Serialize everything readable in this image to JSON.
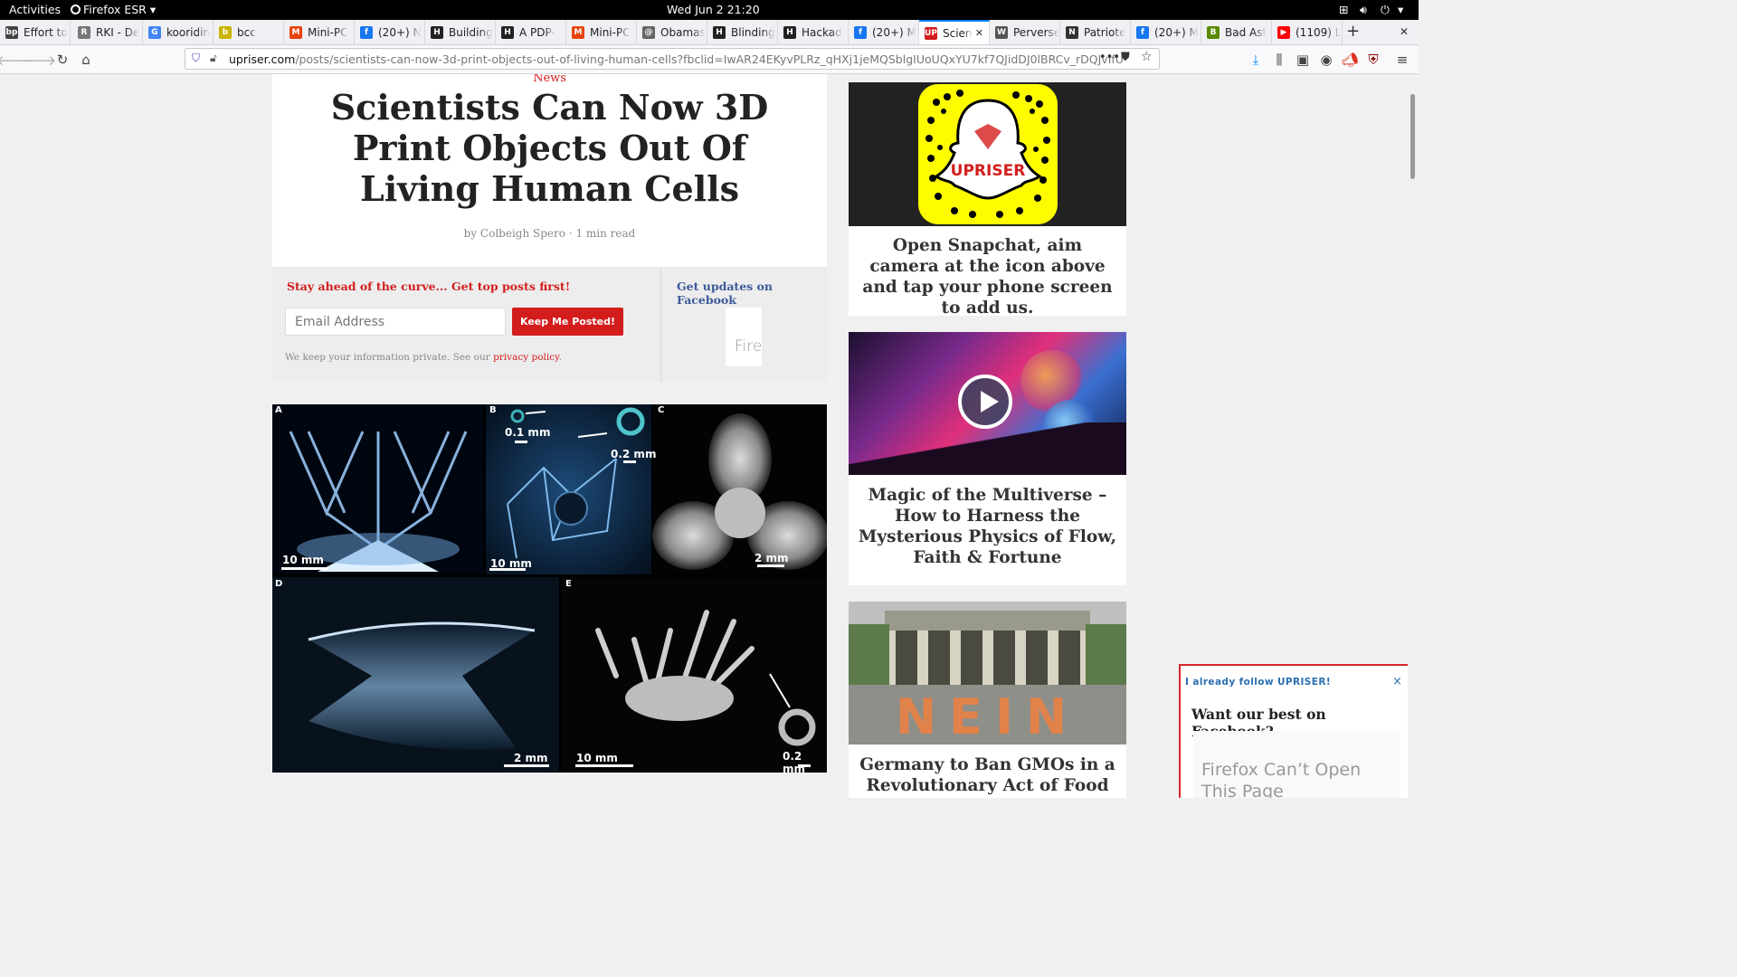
{
  "topbar": {
    "activities": "Activities",
    "app": "Firefox ESR",
    "clock": "Wed Jun 2  21:20"
  },
  "tabs": [
    {
      "label": "Effort to",
      "icon": "bp",
      "color": "#444"
    },
    {
      "label": "RKI - De",
      "icon": "R",
      "color": "#777"
    },
    {
      "label": "kooridin",
      "icon": "G",
      "color": "#4285f4"
    },
    {
      "label": "bcc",
      "icon": "b",
      "color": "#c9b400"
    },
    {
      "label": "Mini-PC",
      "icon": "M",
      "color": "#e8430d"
    },
    {
      "label": "(20+) N",
      "icon": "f",
      "color": "#1877f2"
    },
    {
      "label": "Building",
      "icon": "H",
      "color": "#222"
    },
    {
      "label": "A PDP-",
      "icon": "H",
      "color": "#222"
    },
    {
      "label": "Mini-PC",
      "icon": "M",
      "color": "#e8430d"
    },
    {
      "label": "Obamas",
      "icon": "@",
      "color": "#666"
    },
    {
      "label": "Blinding",
      "icon": "H",
      "color": "#222"
    },
    {
      "label": "Hackad",
      "icon": "H",
      "color": "#222"
    },
    {
      "label": "(20+) M",
      "icon": "f",
      "color": "#1877f2"
    },
    {
      "label": "Scien",
      "icon": "UP",
      "color": "#d31d1d",
      "active": true
    },
    {
      "label": "Perverse",
      "icon": "W",
      "color": "#555"
    },
    {
      "label": "Patriote",
      "icon": "N",
      "color": "#333"
    },
    {
      "label": "(20+) M",
      "icon": "f",
      "color": "#1877f2"
    },
    {
      "label": "Bad Ast",
      "icon": "B",
      "color": "#5b8a00"
    },
    {
      "label": "(1109) L",
      "icon": "▶",
      "color": "#ff0000"
    }
  ],
  "urlbar": {
    "domain": "upriser.com",
    "path": "/posts/scientists-can-now-3d-print-objects-out-of-living-human-cells?fbclid=IwAR24EKyvPLRz_qHXj1jeMQSblgIUoUQxYU7kf7QJidDJ0lBRCv_rDQJvIfU"
  },
  "article": {
    "category": "News",
    "title": "Scientists Can Now 3D Print Objects Out Of Living Human Cells",
    "author": "by Colbeigh Spero",
    "read_time": "1 min read"
  },
  "subscribe": {
    "heading": "Stay ahead of the curve... Get top posts first!",
    "email_placeholder": "Email Address",
    "button": "Keep Me Posted!",
    "privacy_text": "We keep your information private. See our ",
    "privacy_link": "privacy policy",
    "fb_heading": "Get updates on Facebook",
    "fb_frame_text": "Fire"
  },
  "figure": {
    "panels": [
      {
        "letter": "A",
        "scale": "10 mm"
      },
      {
        "letter": "B",
        "scale": "10 mm",
        "inset1": "0.1 mm",
        "inset2": "0.2 mm"
      },
      {
        "letter": "C",
        "scale": "2 mm"
      },
      {
        "letter": "D",
        "scale": "2 mm"
      },
      {
        "letter": "E",
        "scale": "10 mm",
        "inset": "0.2 mm"
      }
    ]
  },
  "sidebar": {
    "snapchat_caption": "Open Snapchat, aim camera at the icon above and tap your phone screen to add us.",
    "snap_brand": "UPRISER",
    "video_title": "Magic of the Multiverse – How to Harness the Mysterious Physics of Flow, Faith & Fortune",
    "gmo_title": "Germany to Ban GMOs in a Revolutionary Act of Food",
    "gmo_image_text": "NEIN"
  },
  "popup": {
    "already": "I already follow UPRISER!",
    "close": "×",
    "heading": "Want our best on Facebook?",
    "frame_text": "Firefox Can’t Open This Page"
  },
  "colors": {
    "brand_red": "#d31d1d",
    "fb_blue": "#3b5998",
    "accent": "#0a84ff"
  }
}
